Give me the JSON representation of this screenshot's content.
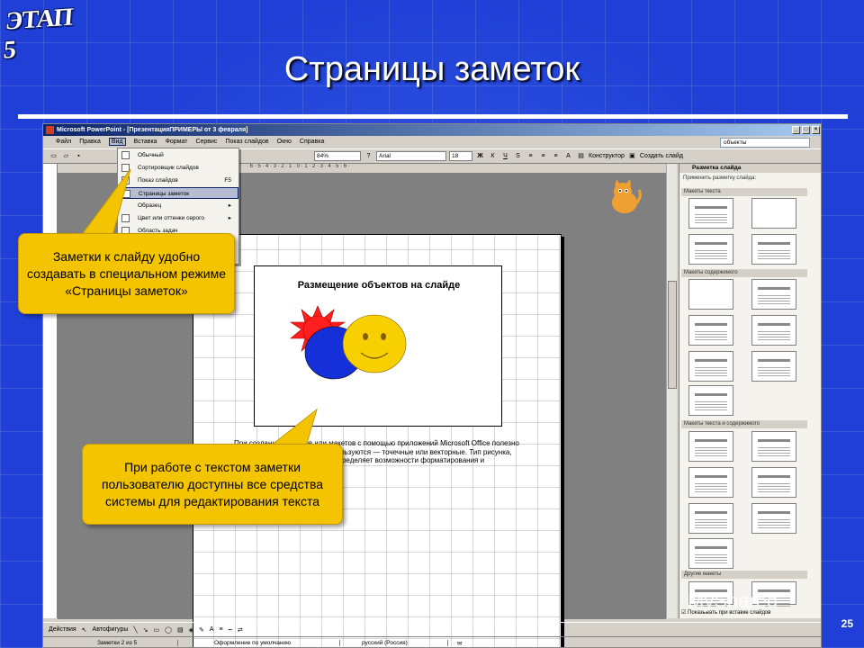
{
  "logo": "ЭТАП 5",
  "title": "Страницы заметок",
  "slide_number": "25",
  "window": {
    "title": "Microsoft PowerPoint - [ПрезентацияПРИМЕРЫ от 3 февраля]",
    "ask_box": "объекты"
  },
  "menu": [
    "Файл",
    "Правка",
    "Вид",
    "Вставка",
    "Формат",
    "Сервис",
    "Показ слайдов",
    "Окно",
    "Справка"
  ],
  "toolbar": {
    "zoom": "84%",
    "font": "Arial",
    "size": "18",
    "designer": "Конструктор",
    "new_slide": "Создать слайд"
  },
  "view_menu": [
    {
      "label": "Обычный",
      "shortcut": ""
    },
    {
      "label": "Сортировщик слайдов",
      "shortcut": ""
    },
    {
      "label": "Показ слайдов",
      "shortcut": "F5"
    },
    {
      "label": "Страницы заметок",
      "shortcut": ""
    },
    {
      "label": "Образец",
      "shortcut": "▸"
    },
    {
      "label": "Цвет или оттенки серого",
      "shortcut": "▸"
    },
    {
      "label": "Область задач",
      "shortcut": ""
    }
  ],
  "notes_page": {
    "slide_title": "Размещение объектов на слайде",
    "notes": "При создании рисунков или макетов с помощью приложений Microsoft Office полезно знать, рисунки какого типа используются — точечные или векторные. Тип рисунка, над которым ведется работа, определяет возможности форматирования и редактирования.",
    "page_number": "2"
  },
  "task_pane": {
    "header": "Разметка слайда",
    "apply": "Применить разметку слайда:",
    "groups": [
      "Макеты текста",
      "Макеты содержимого",
      "Макеты текста и содержимого",
      "Другие макеты"
    ],
    "checkbox": "Показывать при вставке слайдов"
  },
  "drawbar": {
    "actions": "Действия",
    "autoshapes": "Автофигуры"
  },
  "status": [
    "Заметки 2 из 5",
    "Оформление по умолчанию",
    "русский (Россия)"
  ],
  "callouts": {
    "top": "Заметки к слайду удобно создавать в специальном режиме «Страницы заметок»",
    "bottom": "При работе с текстом заметки пользователю доступны все средства системы для редактирования текста"
  },
  "watermark": "MyShared",
  "colors": {
    "background": "#1f3fd6",
    "callout": "#f5c400",
    "sun": "#ff1f1f",
    "circle_blue": "#1530d8",
    "smiley": "#f8d000"
  }
}
